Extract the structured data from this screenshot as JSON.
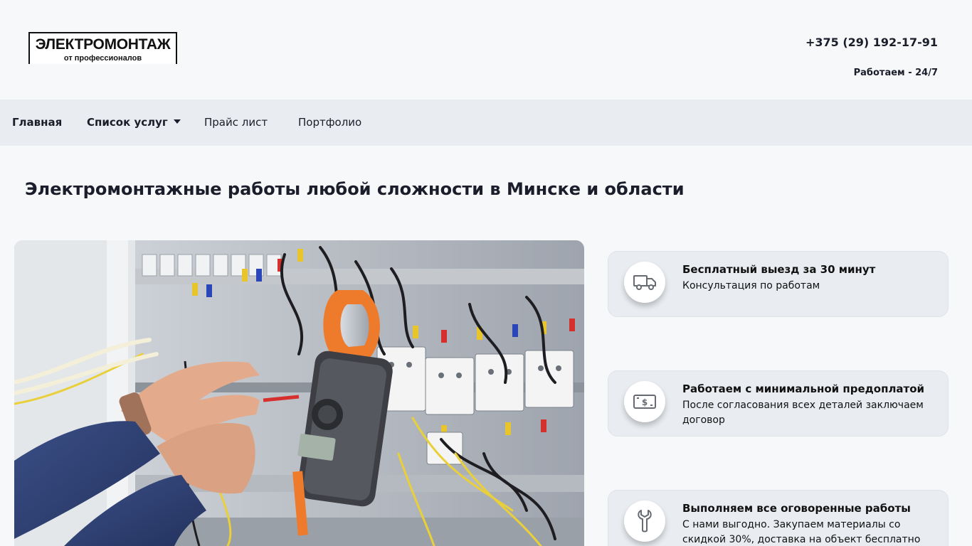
{
  "header": {
    "logo": {
      "title": "ЭЛЕКТРОМОНТАЖ",
      "subtitle": "от профессионалов"
    },
    "phone": "+375 (29) 192-17-91",
    "hours": "Работаем - 24/7"
  },
  "nav": {
    "items": [
      {
        "label": "Главная",
        "active": true
      },
      {
        "label": "Список услуг",
        "dropdown": true
      },
      {
        "label": "Прайс лист"
      },
      {
        "label": "Портфолио"
      }
    ]
  },
  "hero": {
    "title": "Электромонтажные работы любой сложности в Минске и области"
  },
  "features": [
    {
      "icon": "delivery-truck-icon",
      "title": "Бесплатный выезд за 30 минут",
      "text": "Консультация по работам"
    },
    {
      "icon": "money-bill-icon",
      "title": "Работаем с минимальной предоплатой",
      "text": "После согласования всех деталей заключаем договор"
    },
    {
      "icon": "wrench-icon",
      "title": "Выполняем все оговоренные работы",
      "text": "С нами выгодно. Закупаем материалы со скидкой 30%, доставка на объект бесплатно"
    }
  ],
  "colors": {
    "background": "#f7f8fa",
    "navbar": "#e9edf1",
    "text": "#1b1d2b",
    "accent_orange": "#ee7b2c"
  }
}
